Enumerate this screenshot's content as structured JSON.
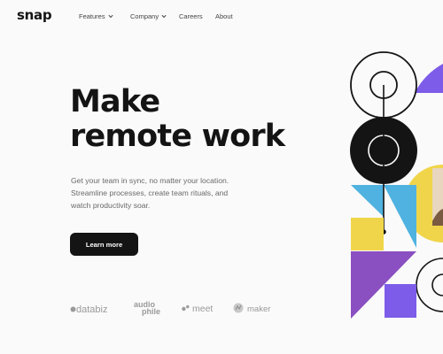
{
  "brand": {
    "logo": "snap"
  },
  "nav": {
    "items": [
      {
        "label": "Features",
        "dropdown": true
      },
      {
        "label": "Company",
        "dropdown": true
      },
      {
        "label": "Careers",
        "dropdown": false
      },
      {
        "label": "About",
        "dropdown": false
      }
    ]
  },
  "hero": {
    "headline_line1": "Make",
    "headline_line2": "remote work",
    "description_lines": [
      "Get your team in sync, no matter your location.",
      "Streamline processes, create team rituals, and",
      "watch productivity soar."
    ],
    "cta_label": "Learn more"
  },
  "clients": [
    {
      "name": "databiz",
      "icon": "databiz-logo"
    },
    {
      "name_line1": "audio",
      "name_line2": "phile",
      "icon": "audiophile-logo"
    },
    {
      "name": "meet",
      "icon": "meet-logo"
    },
    {
      "name": "maker",
      "icon": "maker-logo"
    }
  ],
  "colors": {
    "background": "#fafafa",
    "text_primary": "#141414",
    "text_muted": "#696969",
    "purple": "#7c5ce8",
    "violet": "#8a4fc0",
    "blue": "#4fb2e0",
    "yellow": "#f0d54b",
    "gray_logos": "#9a9a9a"
  }
}
